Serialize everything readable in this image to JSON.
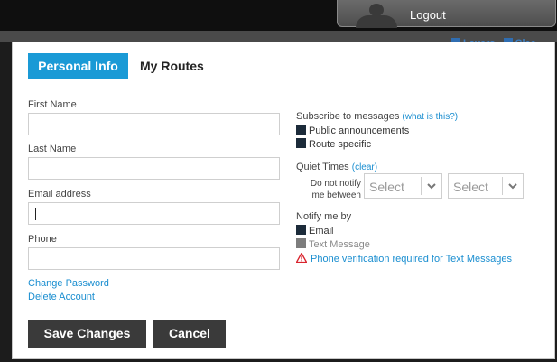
{
  "header": {
    "logout_label": "Logout",
    "layers_label": "Layers",
    "clear_label": "Clea"
  },
  "tabs": [
    {
      "label": "Personal Info",
      "active": true
    },
    {
      "label": "My Routes",
      "active": false
    }
  ],
  "form": {
    "first_name": {
      "label": "First Name",
      "value": ""
    },
    "last_name": {
      "label": "Last Name",
      "value": ""
    },
    "email": {
      "label": "Email address",
      "value": ""
    },
    "phone": {
      "label": "Phone",
      "value": ""
    }
  },
  "links": {
    "change_password": "Change Password",
    "delete_account": "Delete Account"
  },
  "buttons": {
    "save": "Save Changes",
    "cancel": "Cancel"
  },
  "subscribe": {
    "title": "Subscribe to messages",
    "help_link": "(what is this?)",
    "options": [
      {
        "label": "Public announcements",
        "checked": true
      },
      {
        "label": "Route specific",
        "checked": true
      }
    ]
  },
  "quiet_times": {
    "title": "Quiet Times",
    "clear_link": "(clear)",
    "do_not_notify_line1": "Do not notify",
    "do_not_notify_line2": "me between",
    "start_select": "Select",
    "end_select": "Select"
  },
  "notify": {
    "title": "Notify me by",
    "options": [
      {
        "label": "Email",
        "checked": true,
        "disabled": false
      },
      {
        "label": "Text Message",
        "checked": false,
        "disabled": true
      }
    ],
    "warning": "Phone verification required for Text Messages"
  },
  "colors": {
    "accent": "#1a9ad6",
    "link": "#1a8ed0",
    "button": "#3a3a3a",
    "warning_icon": "#d9232d"
  },
  "icons": {
    "user": "user-icon",
    "chevron": "chevron-down-icon",
    "warning": "warning-icon",
    "layers": "layers-icon"
  }
}
